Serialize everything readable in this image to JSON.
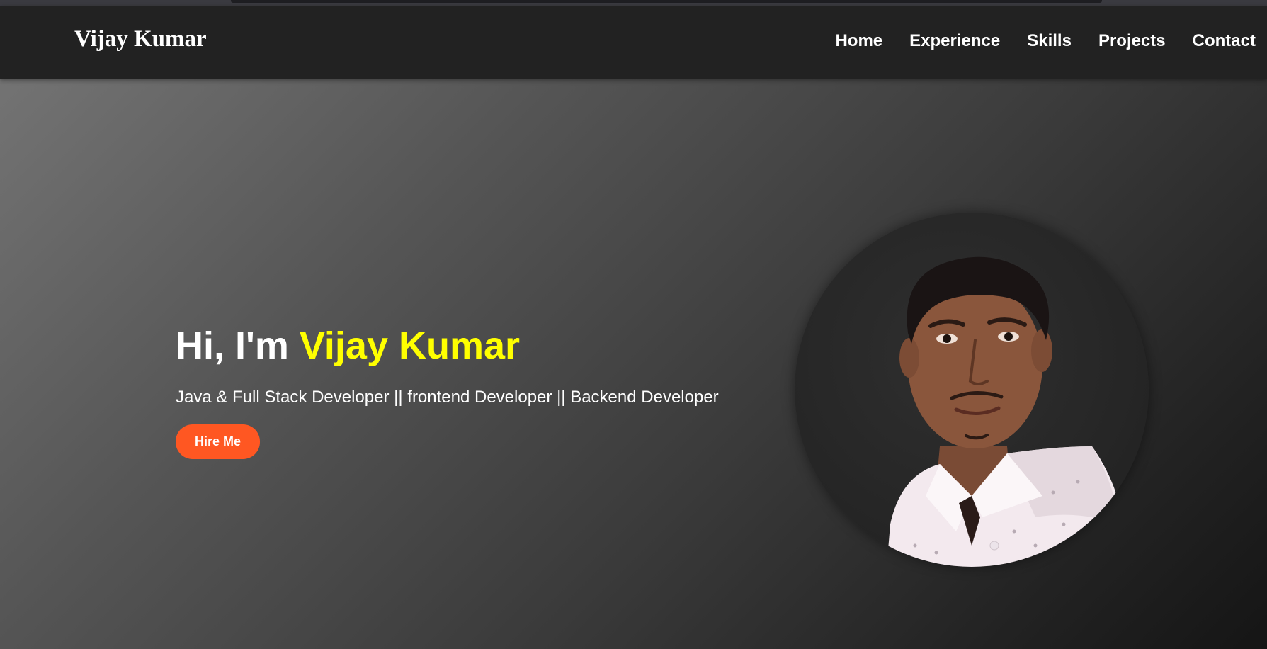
{
  "header": {
    "brand": "Vijay Kumar",
    "nav": [
      "Home",
      "Experience",
      "Skills",
      "Projects",
      "Contact"
    ]
  },
  "hero": {
    "greeting_prefix": "Hi, I'm ",
    "name": "Vijay Kumar",
    "tagline": "Java & Full Stack Developer || frontend Developer || Backend Developer",
    "cta_label": "Hire Me"
  },
  "colors": {
    "navbar_bg": "#222222",
    "name_highlight": "#ffff00",
    "cta_bg": "#ff5722",
    "text": "#ffffff"
  }
}
